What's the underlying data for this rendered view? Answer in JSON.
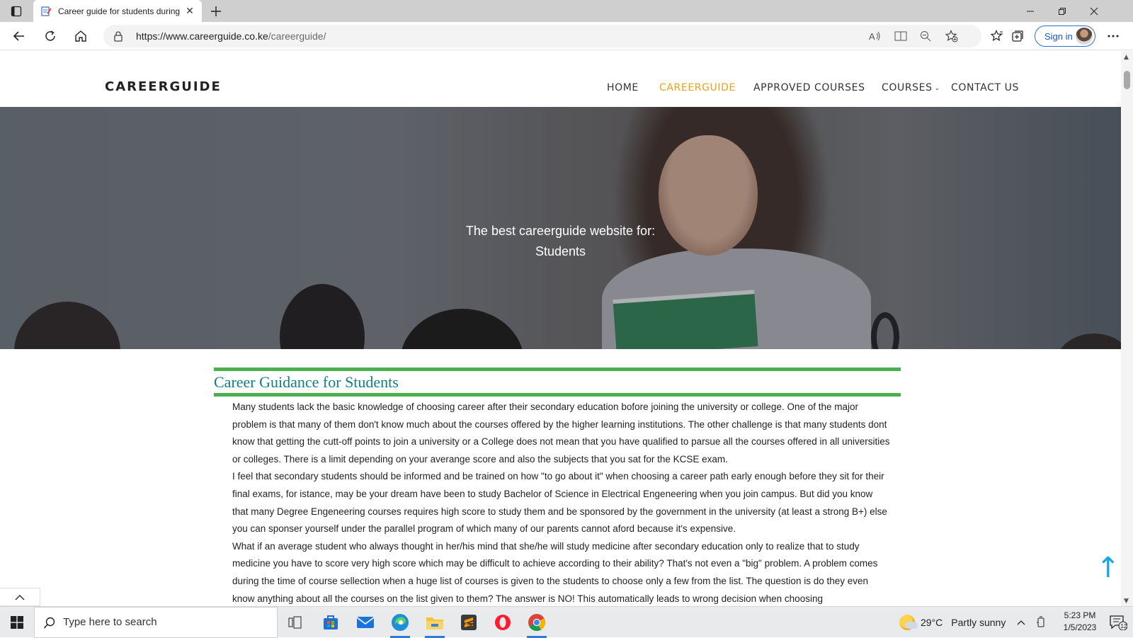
{
  "browser": {
    "tab_title": "Career guide for students during",
    "url_host": "https://www.careerguide.co.ke",
    "url_path": "/careerguide/",
    "sign_in_label": "Sign in"
  },
  "site": {
    "logo": "CAREERGUIDE",
    "nav": [
      {
        "label": "HOME",
        "active": false
      },
      {
        "label": "CAREERGUIDE",
        "active": true
      },
      {
        "label": "APPROVED COURSES",
        "active": false
      },
      {
        "label": "COURSES",
        "active": false
      },
      {
        "label": "CONTACT US",
        "active": false
      }
    ],
    "accent_color": "#eea01a"
  },
  "hero": {
    "line1": "The best careerguide website for:",
    "line2": "Students"
  },
  "article": {
    "title": "Career Guidance for Students",
    "title_color": "#137e7e",
    "rule_color": "#4caf50",
    "paragraphs": [
      "Many students lack the basic knowledge of choosing career after their secondary education bofore joining the university or college. One of the major problem is that many of them don't know much about the courses offered by the higher learning institutions. The other challenge is that many students dont know that getting the cutt-off points to join a university or a College does not mean that you have qualified to parsue all the courses offered in all universities or colleges. There is a limit depending on your averange score and also the subjects that you sat for the KCSE exam.",
      "I feel that secondary students should be informed and be trained on how \"to go about it\" when choosing a career path early enough before they sit for their final exams, for istance, may be your dream have been to study Bachelor of Science in Electrical Engeneering when you join campus. But did you know that many Degree Engeneering courses requires high score to study them and be sponsored by the government in the university (at least a strong B+) else you can sponser yourself under the parallel program of which many of our parents cannot aford because it's expensive.",
      "What if an average student who always thought in her/his mind that she/he will study medicine after secondary education only to realize that to study medicine you have to score very high score which may be difficult to achieve according to their ability? That's not even a \"big\" problem. A problem comes during the time of course sellection when a huge list of courses is given to the students to choose only a few from the list. The question is do they even know anything about all the courses on the list given to them? The answer is NO! This automatically leads to wrong decision when choosing"
    ]
  },
  "taskbar": {
    "search_placeholder": "Type here to search",
    "weather_temp": "29°C",
    "weather_desc": "Partly sunny",
    "time": "5:23 PM",
    "date": "1/5/2023",
    "notification_count": "12"
  }
}
